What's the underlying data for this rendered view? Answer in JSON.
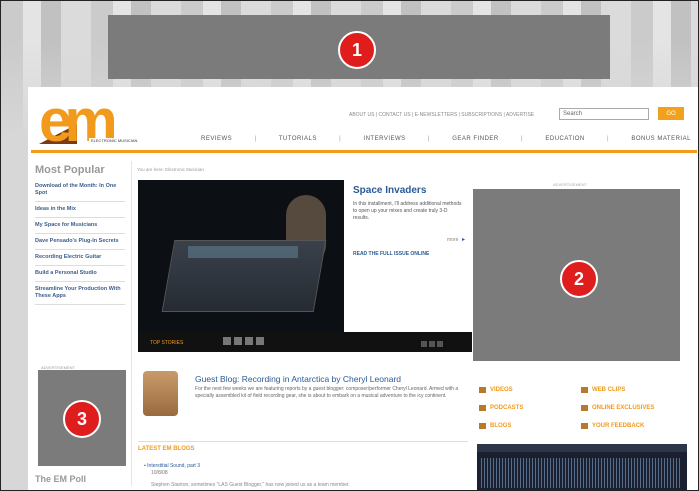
{
  "badges": {
    "top": "1",
    "right": "2",
    "left": "3"
  },
  "side_text": "",
  "header": {
    "logo": "em",
    "logo_tagline": "ELECTRONIC MUSICIAN",
    "top_links": "ABOUT US  |  CONTACT US  |  E-NEWSLETTERS  |  SUBSCRIPTIONS  |  ADVERTISE",
    "search_placeholder": "Search",
    "go_label": "GO",
    "nav": [
      "REVIEWS",
      "TUTORIALS",
      "INTERVIEWS",
      "GEAR FINDER",
      "EDUCATION",
      "BONUS MATERIAL"
    ]
  },
  "sidebar": {
    "title": "Most Popular",
    "items": [
      "Download of the Month: In One Spot",
      "Ideas in the Mix",
      "My Space for Musicians",
      "Dave Pensado's Plug-In Secrets",
      "Recording Electric Guitar",
      "Build a Personal Studio",
      "Streamline Your Production With These Apps"
    ],
    "ad_label": "ADVERTISEMENT",
    "poll_title": "The EM Poll"
  },
  "main": {
    "breadcrumb": "You are here: Electronic Musician",
    "hero_caption": "TOP STORIES",
    "story_title": "Space Invaders",
    "story_text": "In this installment, I'll address additional methods to open up your mixes and create truly 3-D results.",
    "story_more": "more",
    "story_read": "READ THE FULL ISSUE ONLINE",
    "ad_label_right": "ADVERTISEMENT",
    "blog_title": "Guest Blog: Recording in Antarctica by Cheryl Leonard",
    "blog_text": "For the next few weeks we are featuring reports by a guest blogger: composer/performer Cheryl Leonard. Armed with a specially assembled kit of field recording gear, she is about to embark on a musical adventure to the icy continent.",
    "latest_title": "LATEST EM BLOGS",
    "latest_item": "Interstitial Sound, part 3",
    "latest_sub": "10/8/08",
    "latest_text": "Stephen Stanton, sometimes \"LAS Guest Blogger,\" has now joined us as a team member."
  },
  "links": {
    "videos": "VIDEOS",
    "podcasts": "PODCASTS",
    "blogs": "BLOGS",
    "web_clips": "WEB CLIPS",
    "online_exclusives": "ONLINE EXCLUSIVES",
    "your_feedback": "YOUR FEEDBACK"
  }
}
